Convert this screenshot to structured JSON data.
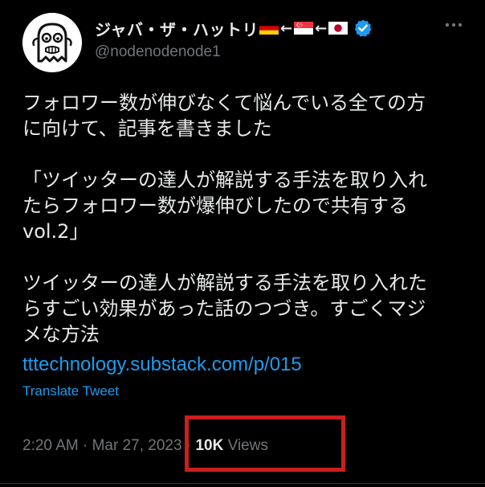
{
  "author": {
    "display_name": "ジャバ・ザ・ハットリ",
    "flag_sequence_arrow": "←",
    "flags": [
      "germany-flag",
      "singapore-flag",
      "japan-flag"
    ],
    "handle": "@nodenodenode1",
    "verified": true,
    "avatar_icon": "ghost-avatar-icon"
  },
  "tweet": {
    "body": "フォロワー数が伸びなくて悩んでいる全ての方\nに向けて、記事を書きました\n\n「ツイッターの達人が解説する手法を取り入れ\nたらフォロワー数が爆伸びしたので共有する\nvol.2」\n\nツイッターの達人が解説する手法を取り入れた\nらすごい効果があった話のつづき。すごくマジ\nメな方法",
    "link": "tttechnology.substack.com/p/015",
    "translate_label": "Translate Tweet",
    "time": "2:20 AM",
    "separator": "·",
    "date": "Mar 27, 2023",
    "views_count": "10K",
    "views_label": "Views"
  },
  "colors": {
    "background": "#000000",
    "text": "#e7e9ea",
    "muted": "#71767b",
    "link": "#1d9bf0",
    "highlight": "#c8201f"
  }
}
